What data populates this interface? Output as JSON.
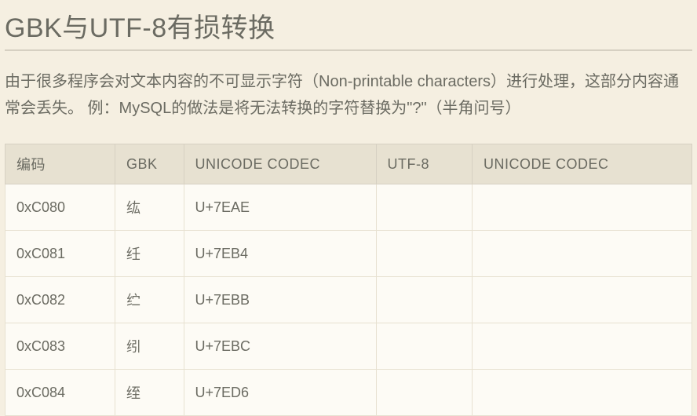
{
  "title": "GBK与UTF-8有损转换",
  "description": "由于很多程序会对文本内容的不可显示字符（Non-printable characters）进行处理，这部分内容通常会丢失。 例：MySQL的做法是将无法转换的字符替换为\"?\"（半角问号）",
  "table": {
    "headers": [
      "编码",
      "GBK",
      "UNICODE CODEC",
      "UTF-8",
      "UNICODE CODEC"
    ],
    "rows": [
      {
        "code": "0xC080",
        "gbk": "纮",
        "unicode1": "U+7EAE",
        "utf8": "",
        "unicode2": ""
      },
      {
        "code": "0xC081",
        "gbk": "纴",
        "unicode1": "U+7EB4",
        "utf8": "",
        "unicode2": ""
      },
      {
        "code": "0xC082",
        "gbk": "纻",
        "unicode1": "U+7EBB",
        "utf8": "",
        "unicode2": ""
      },
      {
        "code": "0xC083",
        "gbk": "纼",
        "unicode1": "U+7EBC",
        "utf8": "",
        "unicode2": ""
      },
      {
        "code": "0xC084",
        "gbk": "绖",
        "unicode1": "U+7ED6",
        "utf8": "",
        "unicode2": ""
      }
    ]
  }
}
